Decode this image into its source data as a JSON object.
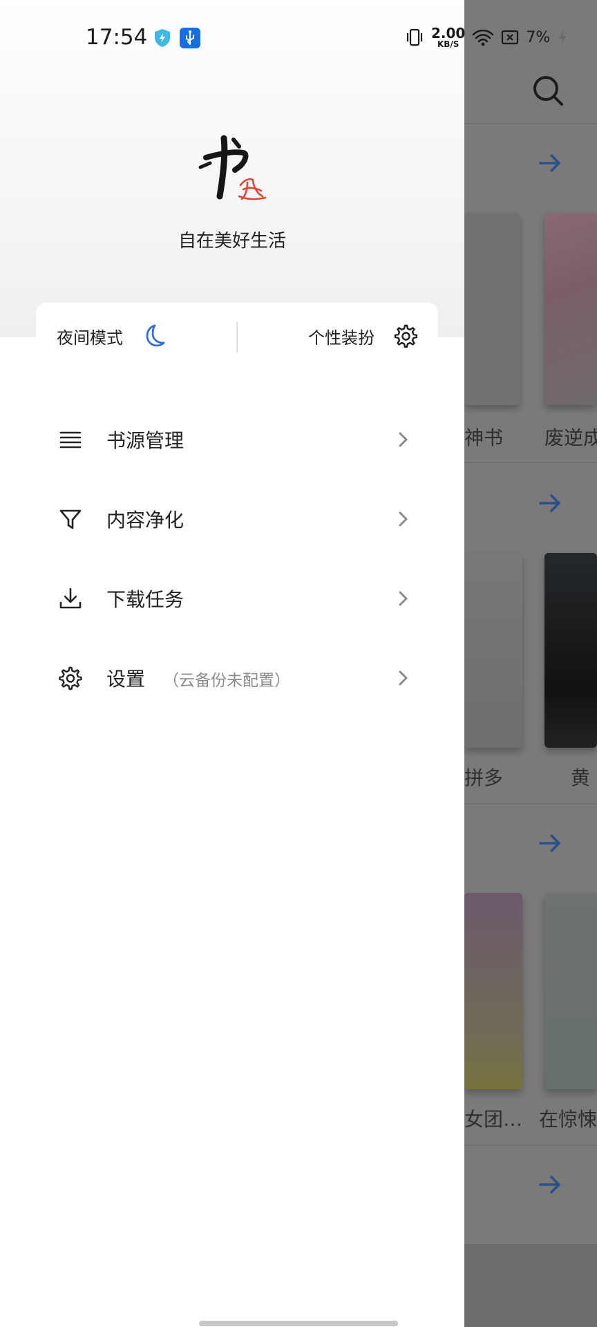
{
  "status_bar": {
    "time": "17:54",
    "net_speed_value": "2.00",
    "net_speed_unit": "KB/S",
    "battery": "7%"
  },
  "drawer": {
    "logo_alt": "书迷",
    "slogan": "自在美好生活",
    "night_mode_label": "夜间模式",
    "theme_label": "个性装扮",
    "menu": [
      {
        "label": "书源管理",
        "icon": "list-icon"
      },
      {
        "label": "内容净化",
        "icon": "filter-icon"
      },
      {
        "label": "下载任务",
        "icon": "download-icon"
      },
      {
        "label": "设置",
        "note": "（云备份未配置）",
        "icon": "gear-icon"
      }
    ]
  },
  "background": {
    "book_titles": [
      "神书",
      "废逆成",
      "拼多",
      "黄",
      "女团…",
      "在惊悚"
    ]
  },
  "colors": {
    "accent_blue": "#2f6fd6",
    "drawer_bg": "#ffffff",
    "scrim": "#7a7a7a"
  }
}
